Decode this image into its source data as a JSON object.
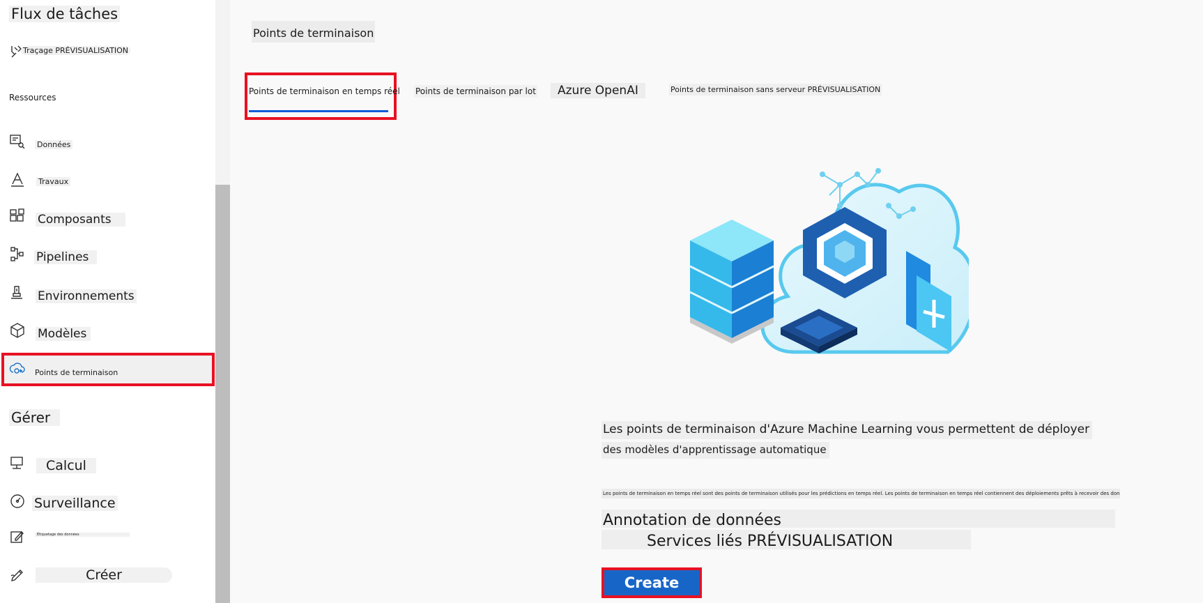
{
  "sidebar": {
    "section_workflows": "Flux de tâches",
    "tracing": {
      "label": "Traçage",
      "badge": "PRÉVISUALISATION"
    },
    "section_resources": "Ressources",
    "items": [
      {
        "label": "Données",
        "icon": "data-icon"
      },
      {
        "label": "Travaux",
        "icon": "jobs-icon"
      },
      {
        "label": "Composants",
        "icon": "components-icon"
      },
      {
        "label": "Pipelines",
        "icon": "pipelines-icon"
      },
      {
        "label": "Environnements",
        "icon": "environments-icon"
      },
      {
        "label": "Modèles",
        "icon": "models-icon"
      },
      {
        "label": "Points de terminaison",
        "icon": "endpoints-icon",
        "selected": true
      }
    ],
    "section_manage": "Gérer",
    "manage_items": [
      {
        "label": "Calcul",
        "icon": "compute-icon"
      },
      {
        "label": "Surveillance",
        "icon": "monitoring-icon"
      },
      {
        "label": "Étiquetage des données",
        "icon": "labeling-icon"
      },
      {
        "label": "Créer",
        "icon": "create-icon"
      }
    ]
  },
  "main": {
    "page_title": "Points de terminaison",
    "tabs": [
      {
        "label": "Points de terminaison en temps réel",
        "selected": true
      },
      {
        "label": "Points de terminaison par lot"
      },
      {
        "label": "Azure OpenAI"
      },
      {
        "label": "Points de terminaison sans serveur PRÉVISUALISATION"
      }
    ],
    "description_line1": "Les points de terminaison d'Azure Machine Learning vous permettent de déployer",
    "description_line2": "des modèles d'apprentissage automatique",
    "fine_print": "Les points de terminaison en temps réel sont des points de terminaison utilisés pour les prédictions en temps réel. Les points de terminaison en temps réel contiennent des déploiements prêts à recevoir des données des c",
    "annotation_title": "Annotation de données",
    "linked_services": "Services liés PRÉVISUALISATION",
    "create_label": "Create"
  },
  "colors": {
    "highlight": "#e81123",
    "tab_underline": "#0f5bd6",
    "create_bg": "#1766c7"
  }
}
